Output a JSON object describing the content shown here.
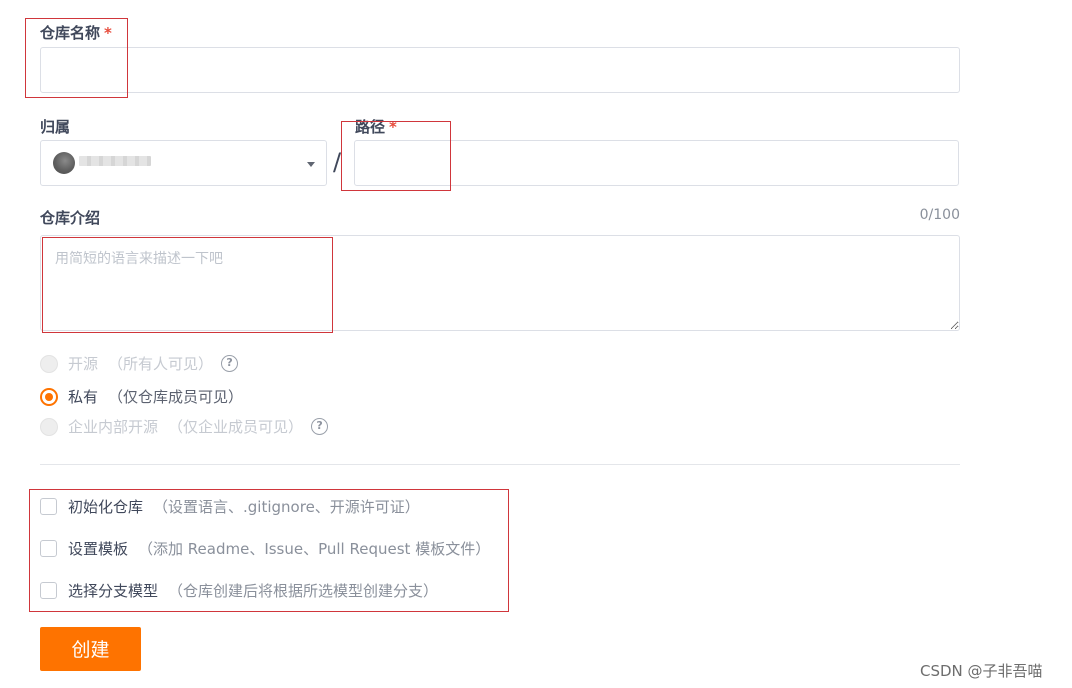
{
  "form": {
    "repo_name": {
      "label": "仓库名称",
      "required_mark": "*",
      "value": ""
    },
    "owner": {
      "label": "归属",
      "selected_value": ""
    },
    "path_separator": "/",
    "path": {
      "label": "路径",
      "required_mark": "*",
      "value": ""
    },
    "description": {
      "label": "仓库介绍",
      "counter": "0/100",
      "placeholder": "用简短的语言来描述一下吧",
      "value": ""
    },
    "visibility": {
      "options": [
        {
          "label": "开源",
          "hint": "（所有人可见）",
          "state": "disabled",
          "has_help": true
        },
        {
          "label": "私有",
          "hint": "（仅仓库成员可见）",
          "state": "checked",
          "has_help": false
        },
        {
          "label": "企业内部开源",
          "hint": "（仅企业成员可见）",
          "state": "disabled",
          "has_help": true
        }
      ],
      "help_icon": "question-circle-icon"
    },
    "extras": [
      {
        "label": "初始化仓库",
        "hint": "（设置语言、.gitignore、开源许可证）",
        "checked": false
      },
      {
        "label": "设置模板",
        "hint": "（添加 Readme、Issue、Pull Request 模板文件）",
        "checked": false
      },
      {
        "label": "选择分支模型",
        "hint": "（仓库创建后将根据所选模型创建分支）",
        "checked": false
      }
    ],
    "submit_label": "创建"
  },
  "colors": {
    "accent": "#fe7300",
    "required": "#e74c3c",
    "annotation": "#d0363b"
  },
  "watermark": "CSDN @子非吾喵"
}
